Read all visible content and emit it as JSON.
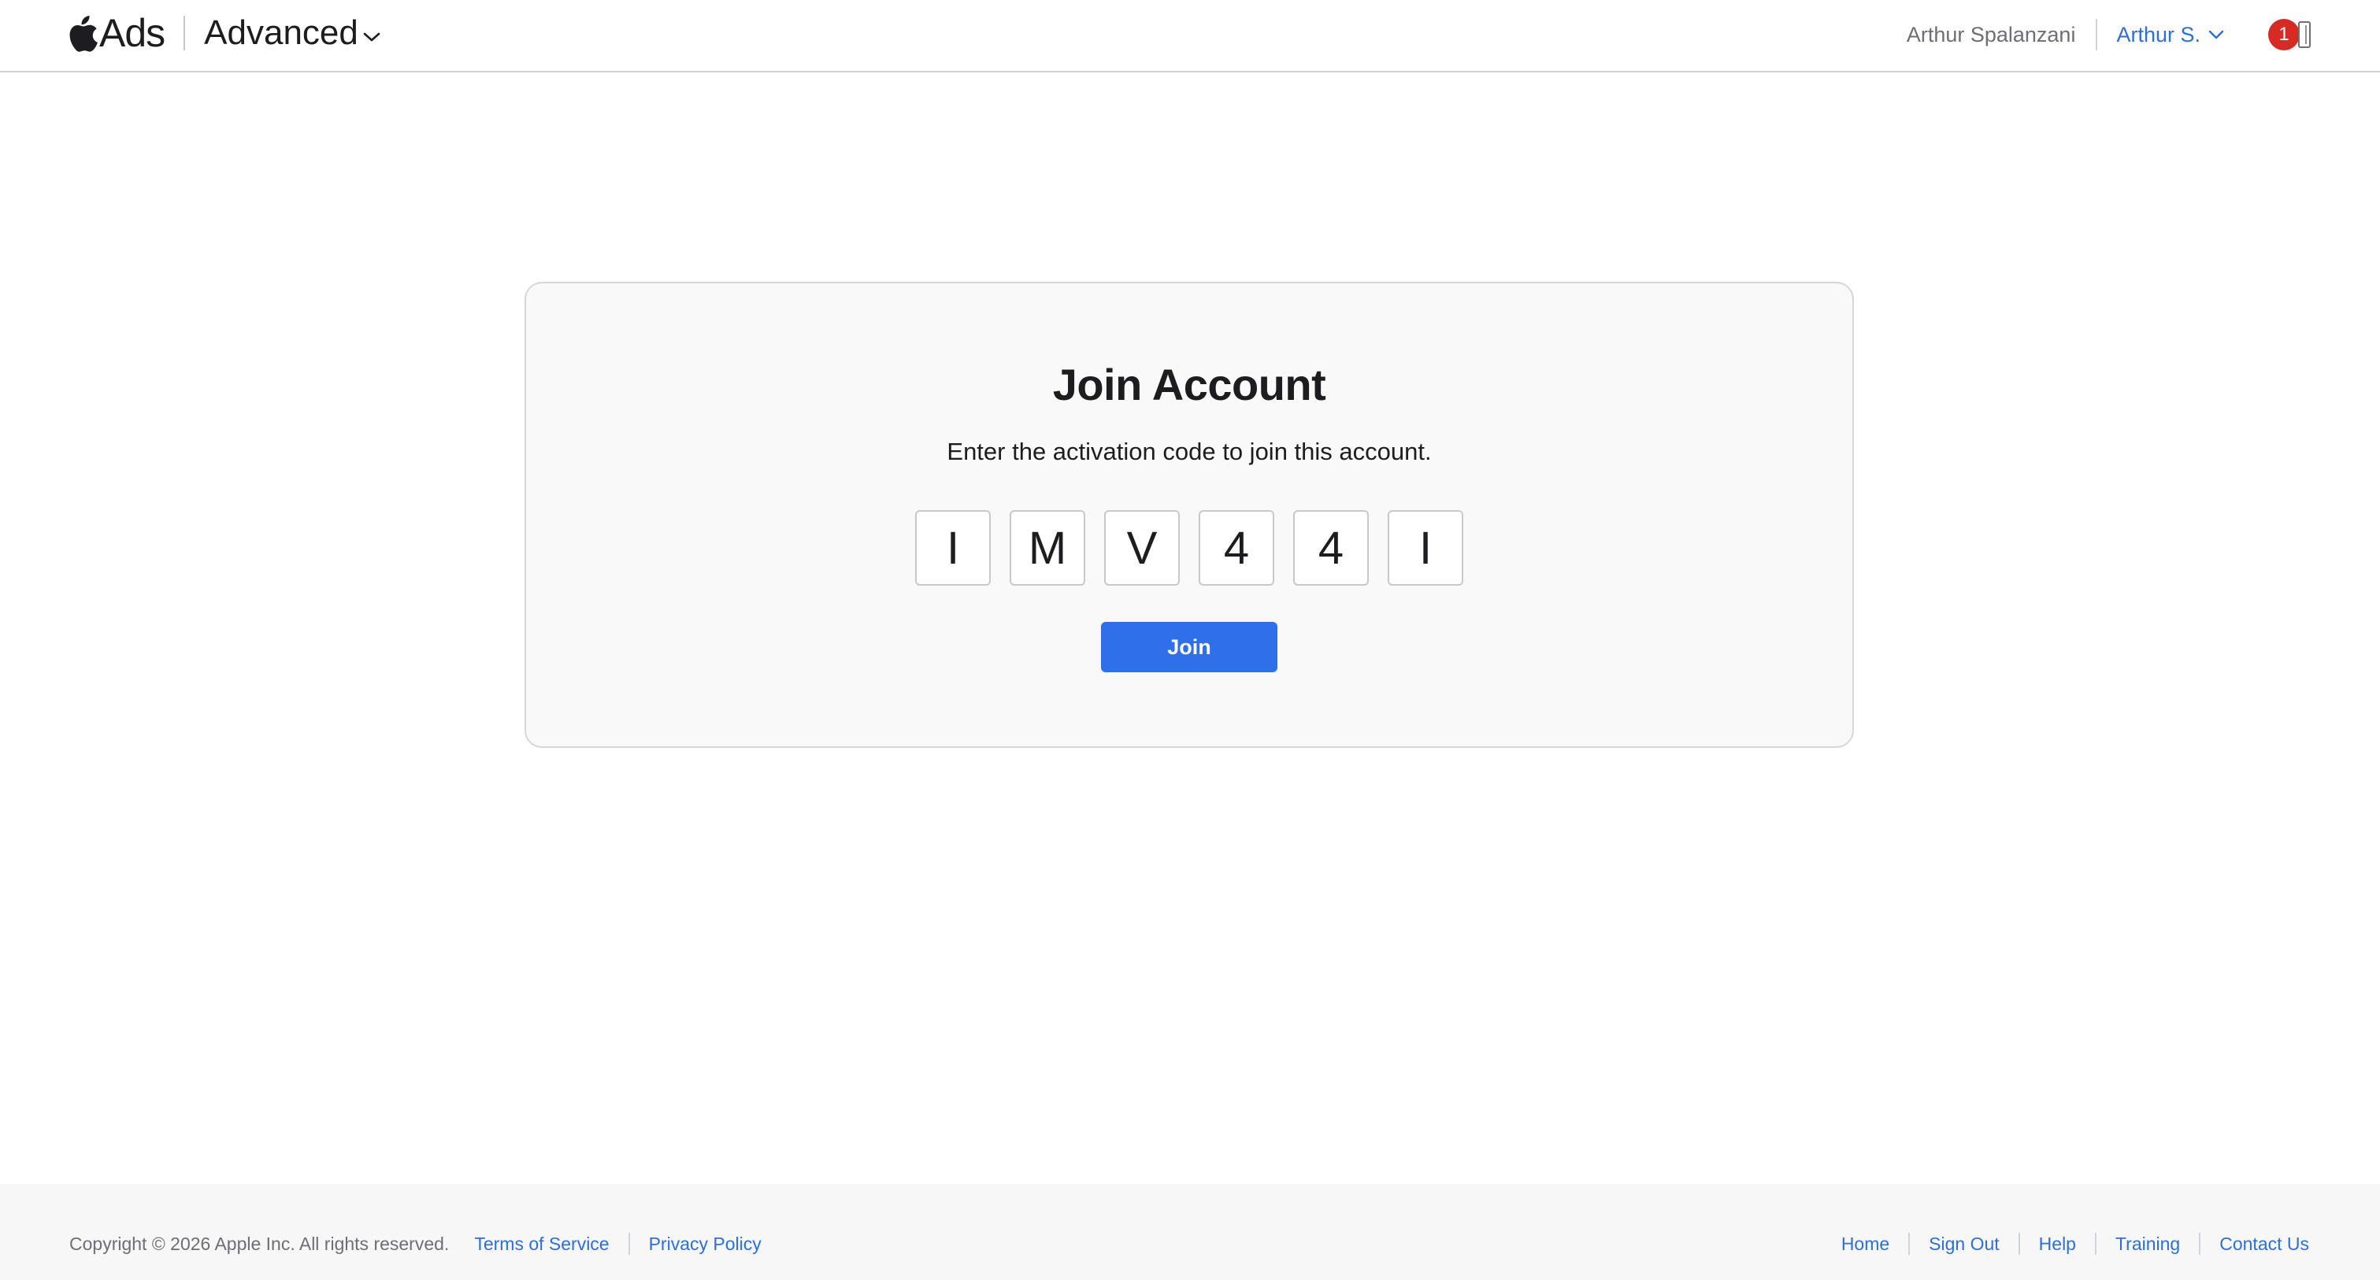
{
  "header": {
    "brand": "Ads",
    "product": "Advanced",
    "org_name": "Arthur Spalanzani",
    "user_menu_label": "Arthur S.",
    "notification_count": "1",
    "accent_color": "#2d6fd9",
    "badge_color": "#d62b23",
    "icons": [
      "apple-logo-icon",
      "chevron-down-icon",
      "notifications-icon"
    ]
  },
  "card": {
    "title": "Join Account",
    "subtitle": "Enter the activation code to join this account.",
    "code": [
      "I",
      "M",
      "V",
      "4",
      "4",
      "I"
    ],
    "join_button": "Join",
    "button_color": "#2f6fea"
  },
  "footer": {
    "copyright": "Copyright © 2026 Apple Inc. All rights reserved.",
    "left_links": [
      "Terms of Service",
      "Privacy Policy"
    ],
    "right_links": [
      "Home",
      "Sign Out",
      "Help",
      "Training",
      "Contact Us"
    ]
  }
}
